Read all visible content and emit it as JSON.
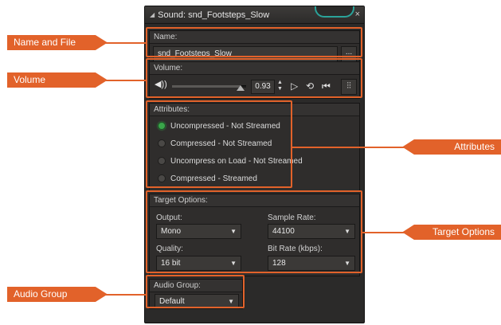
{
  "window": {
    "title": "Sound: snd_Footsteps_Slow",
    "close_label": "×"
  },
  "name_section": {
    "header": "Name:",
    "value": "snd_Footsteps_Slow",
    "browse_label": "..."
  },
  "volume_section": {
    "header": "Volume:",
    "value": "0.93",
    "level": 0.93
  },
  "attributes_section": {
    "header": "Attributes:",
    "options": [
      {
        "label": "Uncompressed - Not Streamed",
        "selected": true
      },
      {
        "label": "Compressed - Not Streamed",
        "selected": false
      },
      {
        "label": "Uncompress on Load - Not Streamed",
        "selected": false
      },
      {
        "label": "Compressed - Streamed",
        "selected": false
      }
    ]
  },
  "target_section": {
    "header": "Target Options:",
    "output_label": "Output:",
    "output_value": "Mono",
    "sample_rate_label": "Sample Rate:",
    "sample_rate_value": "44100",
    "quality_label": "Quality:",
    "quality_value": "16 bit",
    "bit_rate_label": "Bit Rate (kbps):",
    "bit_rate_value": "128"
  },
  "audio_group_section": {
    "header": "Audio Group:",
    "value": "Default"
  },
  "callouts": {
    "name_and_file": "Name and File",
    "volume": "Volume",
    "audio_group": "Audio Group",
    "attributes": "Attributes",
    "target_options": "Target Options"
  },
  "colors": {
    "accent": "#e2622a",
    "window_bg": "#2b2a29",
    "radio_selected": "#3aa64a"
  },
  "icons": {
    "speaker": "speaker-icon",
    "play": "play-icon",
    "loop": "loop-icon",
    "rewind": "rewind-icon",
    "mixer": "mixer-icon",
    "dropdown": "chevron-down-icon"
  }
}
